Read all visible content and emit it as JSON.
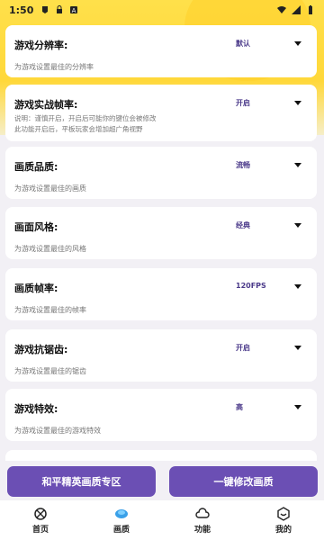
{
  "status_bar": {
    "time": "1:50",
    "icons_left": [
      "notification-icon",
      "lock-icon",
      "app-icon"
    ],
    "icons_right": [
      "wifi-icon",
      "signal-icon",
      "battery-icon"
    ]
  },
  "settings": [
    {
      "title": "游戏分辨率:",
      "value": "默认",
      "desc": "为游戏设置最佳的分辨率"
    },
    {
      "title": "游戏实战帧率:",
      "value": "开启",
      "desc": "说明：谨慎开启，开启后可能你的键位会被修改\n此功能开启后，平板玩家会增加超广角视野"
    },
    {
      "title": "画质品质:",
      "value": "流畅",
      "desc": "为游戏设置最佳的画质"
    },
    {
      "title": "画面风格:",
      "value": "经典",
      "desc": "为游戏设置最佳的风格"
    },
    {
      "title": "画质帧率:",
      "value": "120FPS",
      "desc": "为游戏设置最佳的帧率"
    },
    {
      "title": "游戏抗锯齿:",
      "value": "开启",
      "desc": "为游戏设置最佳的锯齿"
    },
    {
      "title": "游戏特效:",
      "value": "高",
      "desc": "为游戏设置最佳的游戏特效"
    }
  ],
  "buttons": {
    "left": "和平精英画质专区",
    "right": "一键修改画质"
  },
  "tabs": [
    {
      "label": "首页",
      "icon": "home-icon"
    },
    {
      "label": "画质",
      "icon": "quality-icon"
    },
    {
      "label": "功能",
      "icon": "cloud-icon"
    },
    {
      "label": "我的",
      "icon": "profile-icon"
    }
  ],
  "colors": {
    "accent": "#6b4fb4",
    "header": "#ffe04a",
    "value_text": "#4b3a8a"
  }
}
